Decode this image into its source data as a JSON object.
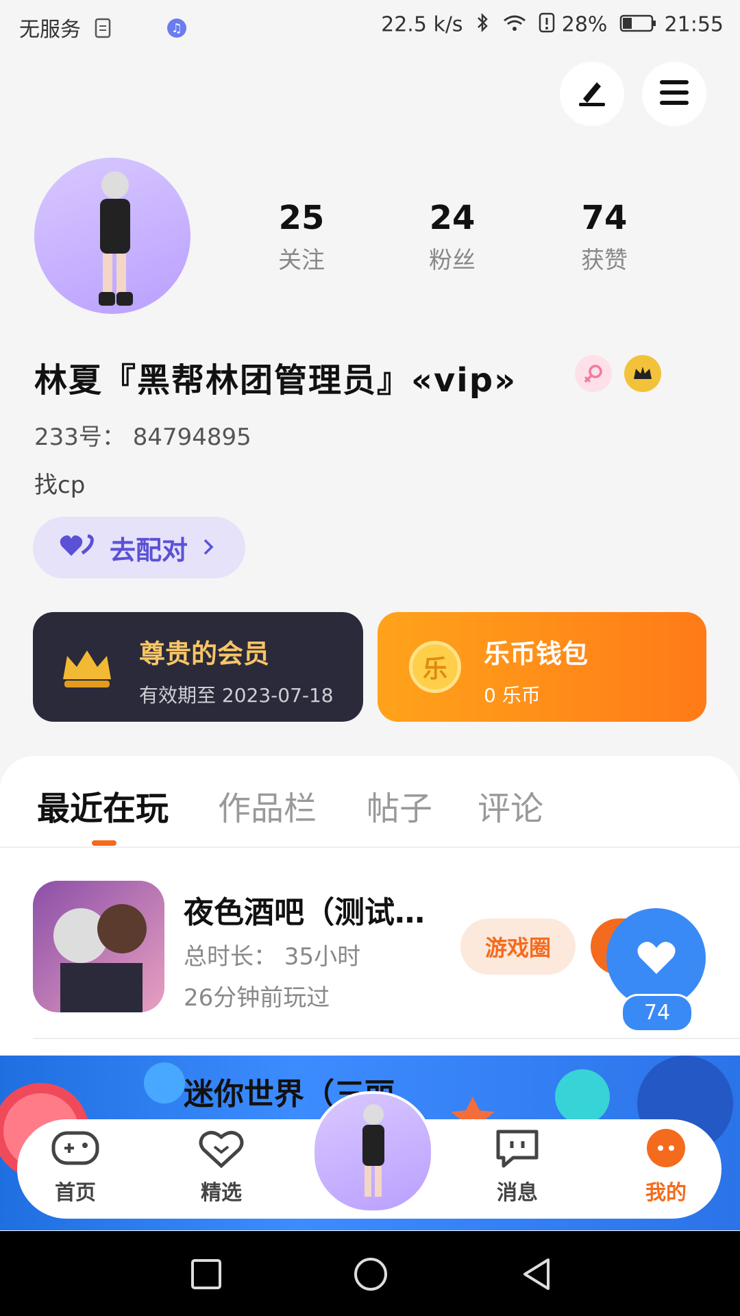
{
  "status_bar": {
    "carrier": "无服务",
    "speed": "22.5 k/s",
    "battery": "28%",
    "time": "21:55"
  },
  "profile": {
    "stats": [
      {
        "value": "25",
        "label": "关注"
      },
      {
        "value": "24",
        "label": "粉丝"
      },
      {
        "value": "74",
        "label": "获赞"
      }
    ],
    "name": "林夏『黑帮林团管理员』«vip»",
    "id_line": "233号： 84794895",
    "bio": "找cp",
    "pair_button": "去配对"
  },
  "cards": {
    "vip": {
      "title": "尊贵的会员",
      "subtitle": "有效期至 2023-07-18"
    },
    "wallet": {
      "title": "乐币钱包",
      "subtitle": "0 乐币",
      "coin_char": "乐"
    }
  },
  "tabs": [
    {
      "label": "最近在玩",
      "active": true
    },
    {
      "label": "作品栏",
      "active": false
    },
    {
      "label": "帖子",
      "active": false
    },
    {
      "label": "评论",
      "active": false
    }
  ],
  "games": [
    {
      "title": "夜色酒吧（测试…",
      "duration": "总时长： 35小时",
      "last_played": "26分钟前玩过",
      "circle_button": "游戏圈"
    },
    {
      "title": "迷你世界（三丽"
    }
  ],
  "floating_like": {
    "count": "74"
  },
  "bottom_nav": [
    {
      "label": "首页",
      "icon": "gamepad-icon"
    },
    {
      "label": "精选",
      "icon": "heart-chat-icon"
    },
    {
      "label": "消息",
      "icon": "message-icon"
    },
    {
      "label": "我的",
      "icon": "me-icon",
      "active": true
    }
  ],
  "colors": {
    "accent": "#f46b1d",
    "vip_card": "#2b2a3a",
    "wallet_card": "#ff8a1a",
    "like_blue": "#3a8af6",
    "pair_purple": "#5b51d6"
  }
}
